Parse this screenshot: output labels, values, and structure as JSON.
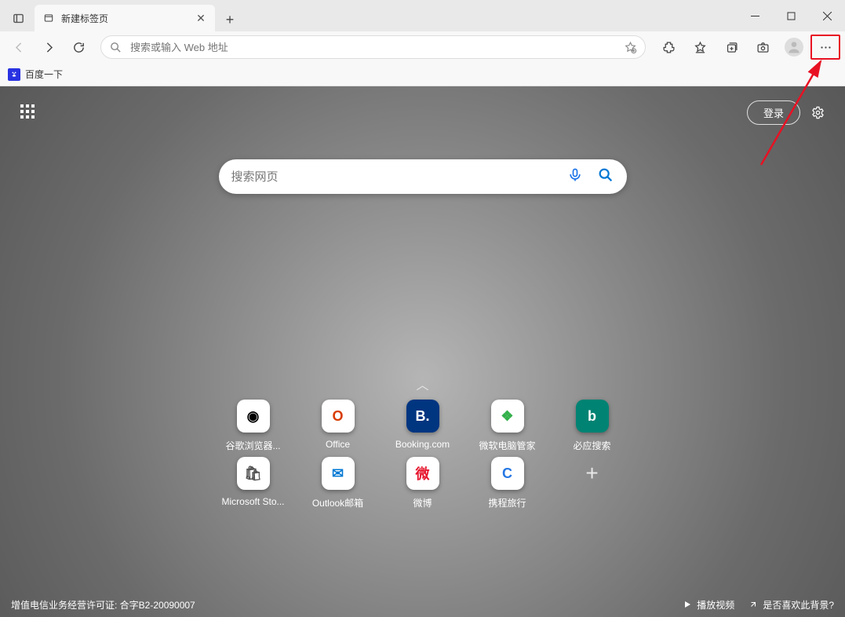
{
  "tab": {
    "title": "新建标签页"
  },
  "addressbar": {
    "placeholder": "搜索或输入 Web 地址"
  },
  "bookmarks": [
    {
      "label": "百度一下"
    }
  ],
  "ntp": {
    "login_label": "登录",
    "search_placeholder": "搜索网页",
    "tiles": [
      {
        "label": "谷歌浏览器...",
        "bg": "#ffffff",
        "fg": "#000",
        "glyph": "◉"
      },
      {
        "label": "Office",
        "bg": "#ffffff",
        "fg": "#d83b01",
        "glyph": "O"
      },
      {
        "label": "Booking.com",
        "bg": "#003580",
        "fg": "#fff",
        "glyph": "B."
      },
      {
        "label": "微软电脑管家",
        "bg": "#ffffff",
        "fg": "#33b04a",
        "glyph": "❖"
      },
      {
        "label": "必应搜索",
        "bg": "#008373",
        "fg": "#fff",
        "glyph": "b"
      },
      {
        "label": "Microsoft Sto...",
        "bg": "#ffffff",
        "fg": "#555",
        "glyph": "🛍"
      },
      {
        "label": "Outlook邮箱",
        "bg": "#ffffff",
        "fg": "#0078d4",
        "glyph": "✉"
      },
      {
        "label": "微博",
        "bg": "#ffffff",
        "fg": "#e6162d",
        "glyph": "微"
      },
      {
        "label": "携程旅行",
        "bg": "#ffffff",
        "fg": "#2577e3",
        "glyph": "C"
      }
    ]
  },
  "footer": {
    "license": "增值电信业务经营许可证: 合字B2-20090007",
    "play_video": "播放视频",
    "like_bg": "是否喜欢此背景?"
  }
}
